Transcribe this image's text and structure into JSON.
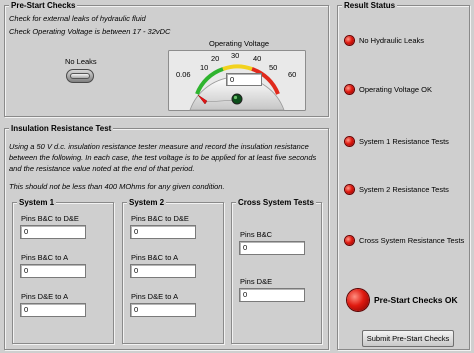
{
  "prestart": {
    "title": "Pre-Start Checks",
    "note1": "Check for external leaks of hydraulic fluid",
    "note2": "Check Operating Voltage is between 17 - 32vDC",
    "leaks_label": "No Leaks",
    "gauge": {
      "label": "Operating Voltage",
      "value": "0",
      "min": 0.06,
      "max": 60,
      "tick_labels": [
        "0.06",
        "10",
        "20",
        "30",
        "40",
        "50",
        "60"
      ]
    }
  },
  "insulation": {
    "title": "Insulation Resistance Test",
    "desc1": "Using a 50 V d.c. insulation resistance tester measure and record the insulation resistance",
    "desc2": "between the following. In each case, the test voltage is to be applied for at least five seconds",
    "desc3": "and the resistance value noted at the end of that period.",
    "desc4": "This should not be less than 400 MOhms for any given condition.",
    "system1": {
      "title": "System 1",
      "fields": [
        {
          "label": "Pins B&C to D&E",
          "value": "0"
        },
        {
          "label": "Pins B&C to A",
          "value": "0"
        },
        {
          "label": "Pins D&E to A",
          "value": "0"
        }
      ]
    },
    "system2": {
      "title": "System 2",
      "fields": [
        {
          "label": "Pins B&C to D&E",
          "value": "0"
        },
        {
          "label": "Pins B&C to A",
          "value": "0"
        },
        {
          "label": "Pins D&E to A",
          "value": "0"
        }
      ]
    },
    "cross": {
      "title": "Cross System Tests",
      "fields": [
        {
          "label": "Pins B&C",
          "value": "0"
        },
        {
          "label": "Pins D&E",
          "value": "0"
        }
      ]
    }
  },
  "result": {
    "title": "Result Status",
    "items": [
      {
        "label": "No Hydraulic Leaks",
        "state": "off"
      },
      {
        "label": "Operating Voltage OK",
        "state": "off"
      },
      {
        "label": "System 1 Resistance Tests",
        "state": "off"
      },
      {
        "label": "System 2 Resistance Tests",
        "state": "off"
      },
      {
        "label": "Cross System Resistance Tests",
        "state": "off"
      }
    ],
    "overall_label": "Pre-Start Checks OK",
    "submit_label": "Submit Pre-Start Checks"
  },
  "colors": {
    "led_off_red": "#e01a10",
    "panel_bg": "#cfcfcf"
  }
}
